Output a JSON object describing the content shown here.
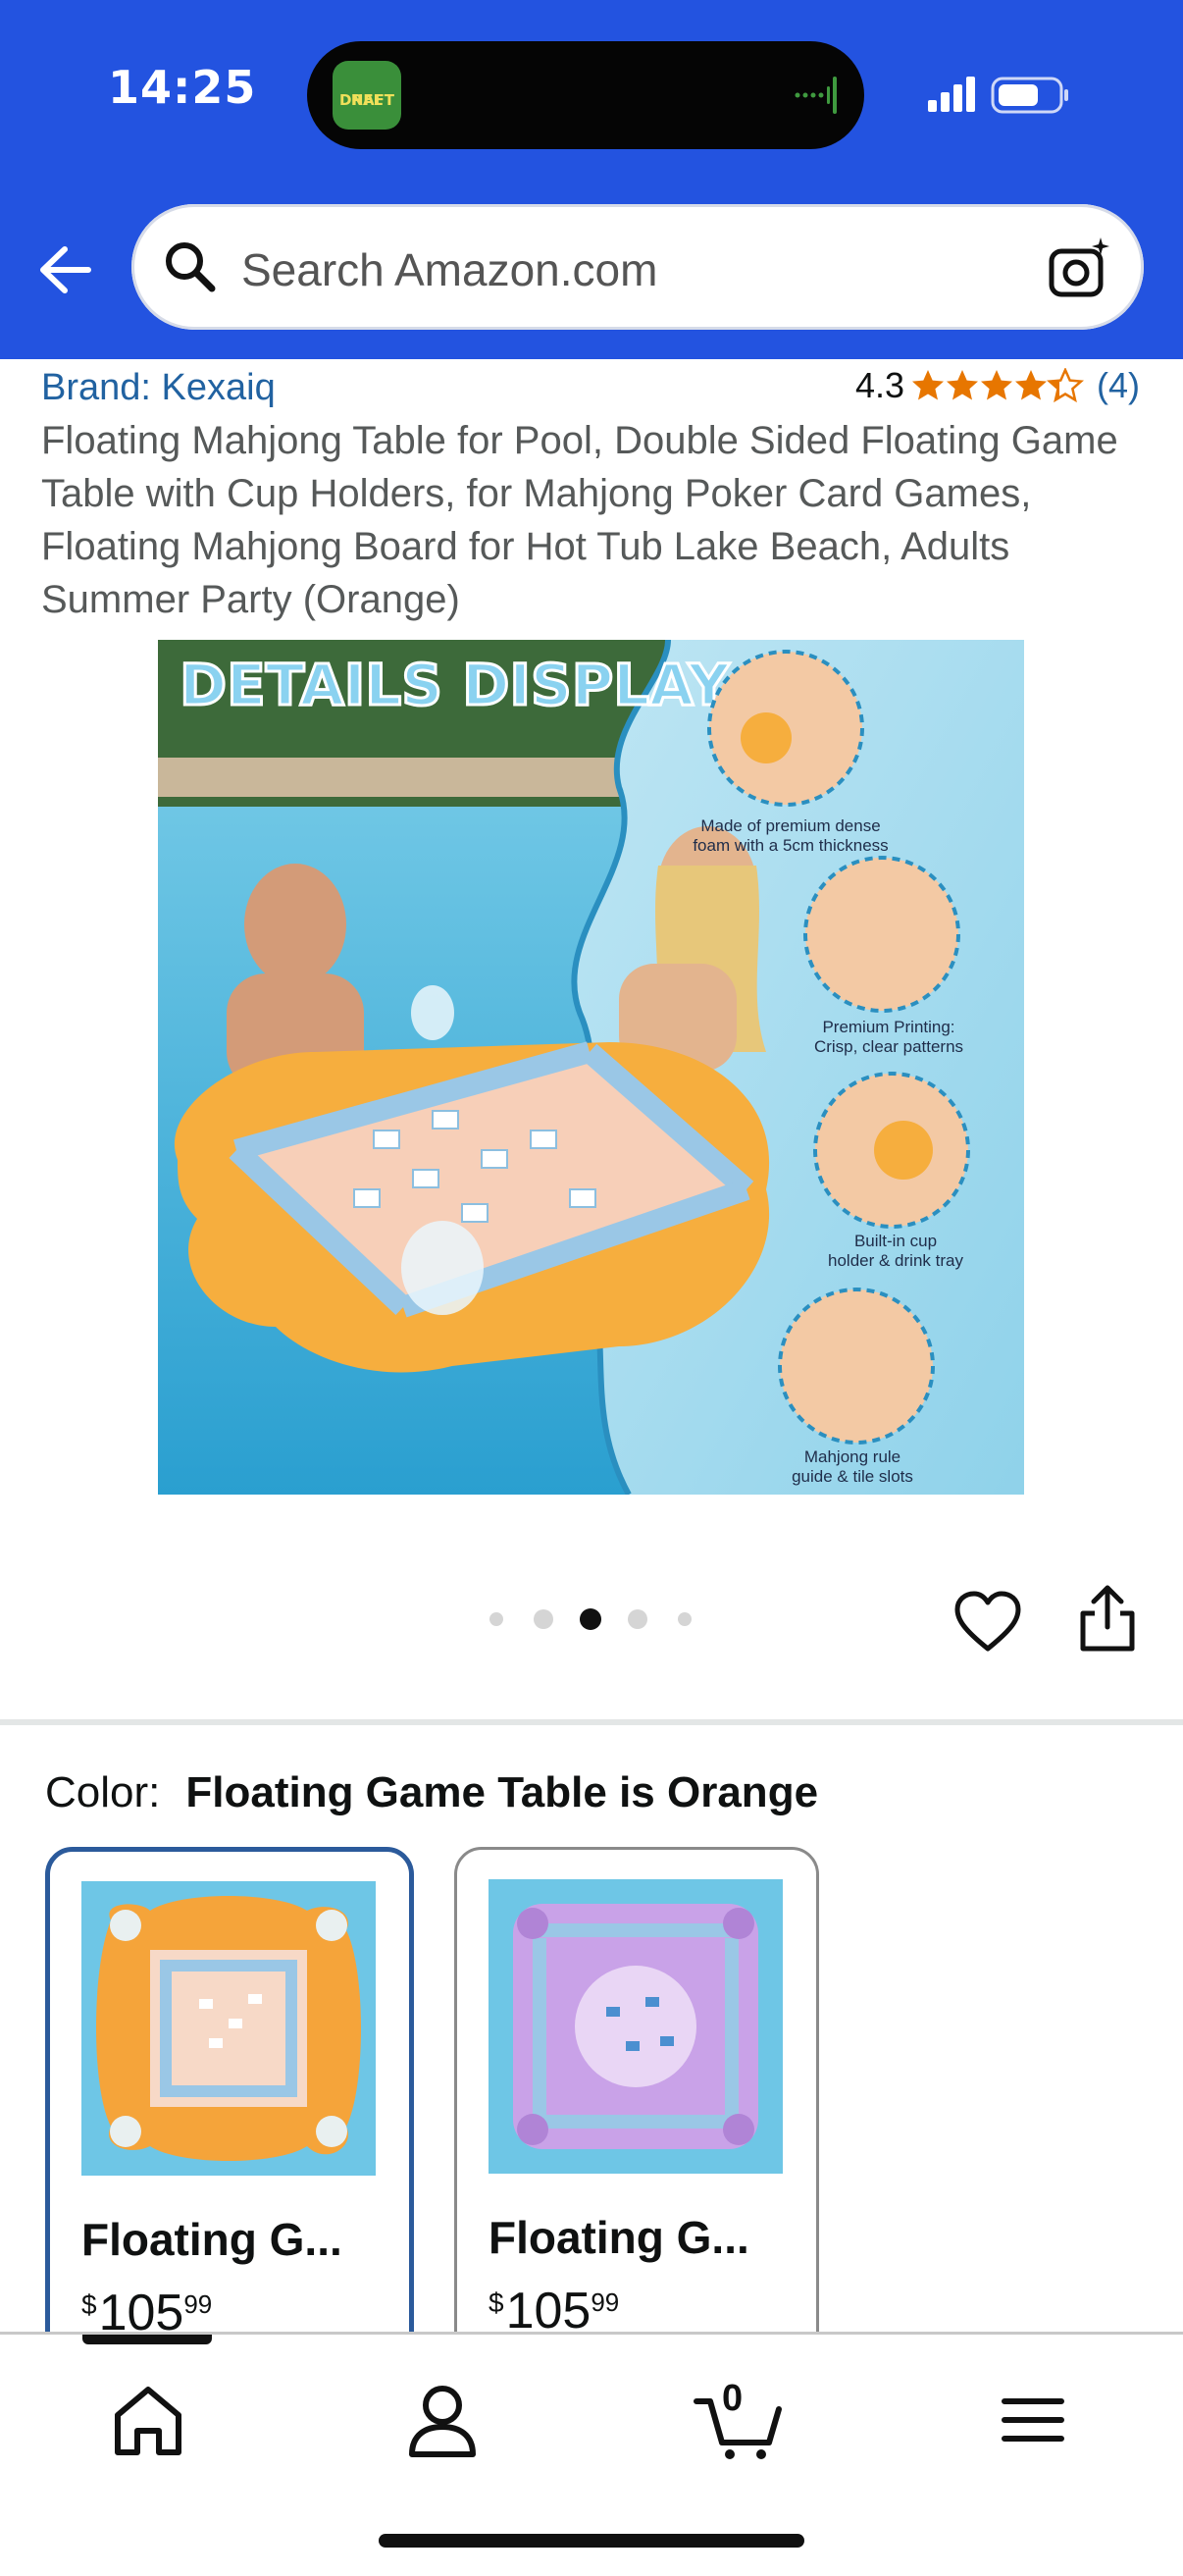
{
  "status_bar": {
    "time": "14:25",
    "island_app_label_lines": [
      "NFL",
      "DRAFT"
    ]
  },
  "search": {
    "placeholder": "Search Amazon.com"
  },
  "product": {
    "brand": "Brand: Kexaiq",
    "rating": "4.3",
    "rating_value": 4.3,
    "rating_count": "(4)",
    "title": "Floating Mahjong Table for Pool, Double Sided Floating Game Table with Cup Holders, for Mahjong Poker Card Games, Floating Mahjong Board for Hot Tub Lake Beach, Adults Summer Party (Orange)",
    "image": {
      "banner": "DETAILS DISPLAY",
      "features": [
        "Made of premium dense foam with a 5cm thickness",
        "Premium Printing: Crisp, clear patterns",
        "Built-in cup holder & drink tray",
        "Mahjong rule guide & tile slots"
      ]
    },
    "carousel": {
      "count": 5,
      "active": 3
    }
  },
  "variation": {
    "label": "Color:",
    "selected": "Floating Game Table is Orange",
    "options": [
      {
        "name": "Floating G...",
        "currency": "$",
        "price_whole": "105",
        "price_fraction": "99",
        "selected": true,
        "color": "#f5a43a"
      },
      {
        "name": "Floating G...",
        "currency": "$",
        "price_whole": "105",
        "price_fraction": "99",
        "selected": false,
        "color": "#c9a2e8"
      }
    ]
  },
  "bottom_nav": {
    "items": [
      "home-icon",
      "account-icon",
      "cart-icon",
      "menu-icon"
    ],
    "cart_count": "0",
    "active": "home"
  },
  "colors": {
    "header": "#2353e0",
    "link": "#2162a1",
    "star": "#e77600",
    "selected_border": "#2b5a9b"
  }
}
